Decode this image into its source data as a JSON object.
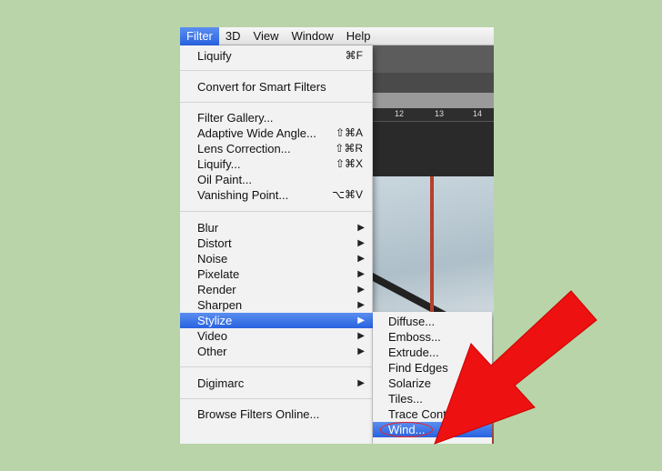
{
  "menubar": {
    "items": [
      "Filter",
      "3D",
      "View",
      "Window",
      "Help"
    ]
  },
  "ruler": {
    "ticks": [
      "12",
      "13",
      "14"
    ]
  },
  "filter_menu": {
    "group1": [
      {
        "label": "Liquify",
        "shortcut": "⌘F"
      }
    ],
    "group2": [
      {
        "label": "Convert for Smart Filters"
      }
    ],
    "group3": [
      {
        "label": "Filter Gallery...",
        "shortcut": ""
      },
      {
        "label": "Adaptive Wide Angle...",
        "shortcut": "⇧⌘A"
      },
      {
        "label": "Lens Correction...",
        "shortcut": "⇧⌘R"
      },
      {
        "label": "Liquify...",
        "shortcut": "⇧⌘X"
      },
      {
        "label": "Oil Paint...",
        "shortcut": ""
      },
      {
        "label": "Vanishing Point...",
        "shortcut": "⌥⌘V"
      }
    ],
    "group4": [
      {
        "label": "Blur"
      },
      {
        "label": "Distort"
      },
      {
        "label": "Noise"
      },
      {
        "label": "Pixelate"
      },
      {
        "label": "Render"
      },
      {
        "label": "Sharpen"
      },
      {
        "label": "Stylize"
      },
      {
        "label": "Video"
      },
      {
        "label": "Other"
      }
    ],
    "group5": [
      {
        "label": "Digimarc"
      }
    ],
    "group6": [
      {
        "label": "Browse Filters Online..."
      }
    ],
    "submenu_arrow": "▶"
  },
  "stylize_submenu": [
    "Diffuse...",
    "Emboss...",
    "Extrude...",
    "Find Edges",
    "Solarize",
    "Tiles...",
    "Trace Contour...",
    "Wind..."
  ],
  "colors": {
    "highlight": "#2862e0",
    "background": "#b8d4a8",
    "arrow": "#ee1111"
  }
}
